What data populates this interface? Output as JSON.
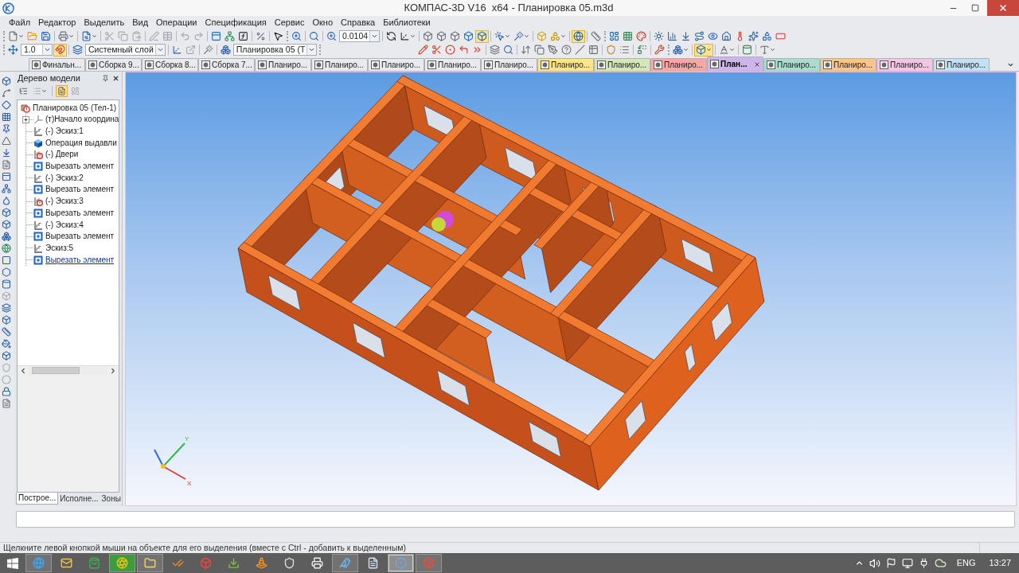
{
  "window": {
    "title": "КОМПАС-3D V16  x64 - Планировка 05.m3d"
  },
  "menu": [
    {
      "label": "Файл"
    },
    {
      "label": "Редактор"
    },
    {
      "label": "Выделить"
    },
    {
      "label": "Вид"
    },
    {
      "label": "Операции"
    },
    {
      "label": "Спецификация"
    },
    {
      "label": "Сервис"
    },
    {
      "label": "Окно"
    },
    {
      "label": "Справка"
    },
    {
      "label": "Библиотеки"
    }
  ],
  "toolbar_rows": [
    {
      "controls": [
        {
          "kind": "button",
          "pressed": false
        },
        {
          "kind": "button",
          "pressed": false
        },
        {
          "kind": "button",
          "pressed": false
        },
        {
          "kind": "button",
          "pressed": false
        },
        {
          "kind": "button",
          "pressed": false
        },
        {
          "kind": "button",
          "pressed": false
        },
        {
          "kind": "button",
          "pressed": false
        },
        {
          "kind": "button",
          "pressed": false
        },
        {
          "kind": "button",
          "pressed": false
        },
        {
          "kind": "button",
          "pressed": false
        },
        {
          "kind": "button",
          "pressed": false
        },
        {
          "kind": "button",
          "pressed": false
        },
        {
          "kind": "button",
          "pressed": false
        },
        {
          "kind": "button",
          "pressed": false
        },
        {
          "kind": "button",
          "pressed": false
        },
        {
          "kind": "button",
          "pressed": false
        },
        {
          "kind": "button",
          "pressed": false
        },
        {
          "kind": "button",
          "pressed": false
        },
        {
          "kind": "button",
          "pressed": false
        },
        {
          "kind": "button",
          "pressed": false
        },
        {
          "kind": "combo",
          "value": "0.0104"
        },
        {
          "kind": "button",
          "pressed": false
        },
        {
          "kind": "button",
          "pressed": false
        },
        {
          "kind": "button",
          "pressed": false
        },
        {
          "kind": "button",
          "pressed": false
        },
        {
          "kind": "button",
          "pressed": false
        },
        {
          "kind": "button",
          "pressed": false
        },
        {
          "kind": "button",
          "pressed": true
        },
        {
          "kind": "button",
          "pressed": false
        },
        {
          "kind": "button",
          "pressed": false
        },
        {
          "kind": "button",
          "pressed": false
        },
        {
          "kind": "button",
          "pressed": false
        },
        {
          "kind": "button",
          "pressed": true
        },
        {
          "kind": "button",
          "pressed": false
        },
        {
          "kind": "button",
          "pressed": false
        },
        {
          "kind": "button",
          "pressed": false
        },
        {
          "kind": "button",
          "pressed": false
        },
        {
          "kind": "button",
          "pressed": false
        },
        {
          "kind": "button",
          "pressed": false
        },
        {
          "kind": "button",
          "pressed": false
        },
        {
          "kind": "button",
          "pressed": false
        },
        {
          "kind": "button",
          "pressed": false
        },
        {
          "kind": "button",
          "pressed": false
        },
        {
          "kind": "button",
          "pressed": false
        },
        {
          "kind": "button",
          "pressed": false
        },
        {
          "kind": "button",
          "pressed": false
        },
        {
          "kind": "button",
          "pressed": false
        }
      ]
    },
    {
      "controls": [
        {
          "kind": "button",
          "pressed": false
        },
        {
          "kind": "combo",
          "value": "1.0"
        },
        {
          "kind": "button",
          "pressed": true
        },
        {
          "kind": "button",
          "pressed": false
        },
        {
          "kind": "combo",
          "value": "Системный слой"
        },
        {
          "kind": "button",
          "pressed": false
        },
        {
          "kind": "button",
          "pressed": false
        },
        {
          "kind": "button",
          "pressed": false
        },
        {
          "kind": "button",
          "pressed": false
        },
        {
          "kind": "combo",
          "value": "Планировка 05 (Т"
        },
        {
          "kind": "button",
          "pressed": false
        },
        {
          "kind": "button",
          "pressed": false
        },
        {
          "kind": "button",
          "pressed": false
        },
        {
          "kind": "button",
          "pressed": false
        },
        {
          "kind": "button",
          "pressed": false
        },
        {
          "kind": "button",
          "pressed": false
        },
        {
          "kind": "button",
          "pressed": false
        },
        {
          "kind": "button",
          "pressed": false
        },
        {
          "kind": "button",
          "pressed": false
        },
        {
          "kind": "button",
          "pressed": false
        },
        {
          "kind": "button",
          "pressed": false
        },
        {
          "kind": "button",
          "pressed": false
        },
        {
          "kind": "button",
          "pressed": false
        },
        {
          "kind": "button",
          "pressed": false
        },
        {
          "kind": "button",
          "pressed": false
        },
        {
          "kind": "button",
          "pressed": false
        },
        {
          "kind": "button",
          "pressed": false
        },
        {
          "kind": "button",
          "pressed": false
        },
        {
          "kind": "button",
          "pressed": true
        },
        {
          "kind": "button",
          "pressed": false
        },
        {
          "kind": "button",
          "pressed": false
        },
        {
          "kind": "button",
          "pressed": false
        }
      ]
    }
  ],
  "document_tabs": [
    {
      "label": "Финальн...",
      "color": "#e9eaee",
      "selected": false
    },
    {
      "label": "Сборка 9...",
      "color": "#e9eaee",
      "selected": false
    },
    {
      "label": "Сборка 8...",
      "color": "#e9eaee",
      "selected": false
    },
    {
      "label": "Сборка 7...",
      "color": "#e9eaee",
      "selected": false
    },
    {
      "label": "Планиро...",
      "color": "#e9eaee",
      "selected": false
    },
    {
      "label": "Планиро...",
      "color": "#e9eaee",
      "selected": false
    },
    {
      "label": "Планиро...",
      "color": "#e9eaee",
      "selected": false
    },
    {
      "label": "Планиро...",
      "color": "#e9eaee",
      "selected": false
    },
    {
      "label": "Планиро...",
      "color": "#e9eaee",
      "selected": false
    },
    {
      "label": "Планиро...",
      "color": "#fde58c",
      "selected": false
    },
    {
      "label": "Планиро...",
      "color": "#d3e7b8",
      "selected": false
    },
    {
      "label": "Планиро...",
      "color": "#f4a9a6",
      "selected": false
    },
    {
      "label": "План...",
      "color": "#cdb5ea",
      "selected": true
    },
    {
      "label": "Планиро...",
      "color": "#a9dccd",
      "selected": false
    },
    {
      "label": "Планиро...",
      "color": "#f9c58d",
      "selected": false
    },
    {
      "label": "Планиро...",
      "color": "#f5c6e3",
      "selected": false
    },
    {
      "label": "Планиро...",
      "color": "#c3e1f5",
      "selected": false
    }
  ],
  "model_tree": {
    "title": "Дерево модели",
    "toolbar": [
      {
        "pressed": false
      },
      {
        "pressed": false
      },
      {
        "pressed": true
      },
      {
        "pressed": false
      }
    ],
    "root": {
      "label": "Планировка 05 (Тел-1)",
      "kind": "part",
      "children": [
        {
          "label": "(т)Начало координа",
          "kind": "origin",
          "expanded": false,
          "hovered": false
        },
        {
          "label": "(-) Эскиз:1",
          "kind": "sketch",
          "hovered": false
        },
        {
          "label": "Операция выдавли",
          "kind": "extrude",
          "hovered": false
        },
        {
          "label": "(-) Двери",
          "kind": "library",
          "hovered": false
        },
        {
          "label": "Вырезать элемент",
          "kind": "cut",
          "hovered": false
        },
        {
          "label": "(-) Эскиз:2",
          "kind": "sketch",
          "hovered": false
        },
        {
          "label": "Вырезать элемент",
          "kind": "cut",
          "hovered": false
        },
        {
          "label": "(-) Эскиз:3",
          "kind": "library",
          "hovered": false
        },
        {
          "label": "Вырезать элемент",
          "kind": "cut",
          "hovered": false
        },
        {
          "label": "(-) Эскиз:4",
          "kind": "sketch",
          "hovered": false
        },
        {
          "label": "Вырезать элемент",
          "kind": "cut",
          "hovered": false
        },
        {
          "label": "Эскиз:5",
          "kind": "sketch",
          "hovered": false
        },
        {
          "label": "Вырезать элемент",
          "kind": "cut",
          "hovered": true
        }
      ]
    },
    "tabs": [
      {
        "label": "Построе...",
        "selected": true
      },
      {
        "label": "Исполне...",
        "selected": false
      },
      {
        "label": "Зоны",
        "selected": false
      }
    ]
  },
  "viewport": {
    "axis_labels": [
      {
        "kind": "y",
        "text": "Y"
      },
      {
        "kind": "x",
        "text": "X"
      }
    ]
  },
  "status_bar": {
    "message": "Щелкните левой кнопкой мыши на объекте для его выделения (вместе с Ctrl - добавить к выделенным)"
  },
  "taskbar": {
    "apps": [
      {
        "running": true,
        "selected": false,
        "flashing": false
      },
      {
        "running": false,
        "selected": false,
        "flashing": false
      },
      {
        "running": false,
        "selected": false,
        "flashing": false
      },
      {
        "running": true,
        "selected": false,
        "flashing": true
      },
      {
        "running": true,
        "selected": false,
        "flashing": false
      },
      {
        "running": false,
        "selected": false,
        "flashing": false
      },
      {
        "running": false,
        "selected": false,
        "flashing": false
      },
      {
        "running": false,
        "selected": false,
        "flashing": false
      },
      {
        "running": false,
        "selected": false,
        "flashing": false
      },
      {
        "running": false,
        "selected": false,
        "flashing": false
      },
      {
        "running": false,
        "selected": false,
        "flashing": false
      },
      {
        "running": true,
        "selected": false,
        "flashing": false
      },
      {
        "running": false,
        "selected": false,
        "flashing": false
      },
      {
        "running": true,
        "selected": true,
        "flashing": false
      },
      {
        "running": true,
        "selected": false,
        "flashing": false
      }
    ],
    "language": "ENG",
    "clock": "13:27"
  }
}
